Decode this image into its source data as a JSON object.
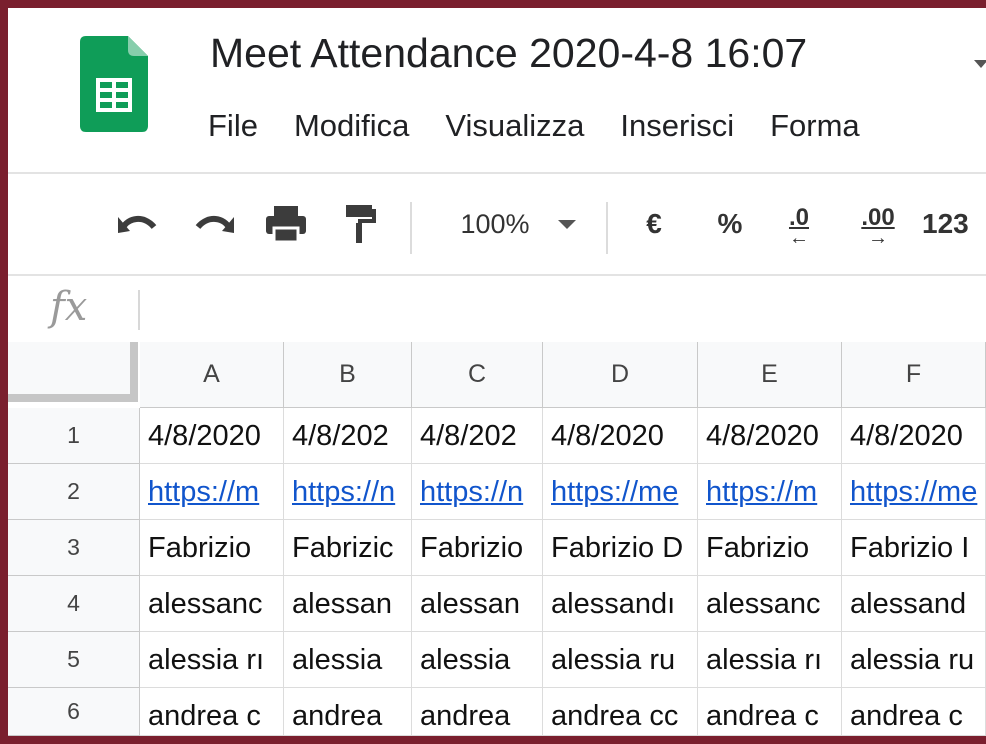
{
  "doc": {
    "title": "Meet Attendance 2020-4-8 16:07"
  },
  "icons": {
    "logo": "google-sheets-logo",
    "brand_color": "#0f9d58"
  },
  "menu": [
    "File",
    "Modifica",
    "Visualizza",
    "Inserisci",
    "Forma"
  ],
  "toolbar": {
    "undo": "undo-icon",
    "redo": "redo-icon",
    "print": "print-icon",
    "paint": "paint-format-icon",
    "zoom": "100%",
    "currency": "€",
    "percent": "%",
    "dec_less": ".0",
    "dec_more": ".00",
    "more_formats": "123"
  },
  "formula_bar": {
    "fx": "fx"
  },
  "sheet": {
    "columns": [
      "A",
      "B",
      "C",
      "D",
      "E",
      "F"
    ],
    "rows": [
      {
        "num": "1",
        "cells": [
          "4/8/2020",
          "4/8/202",
          "4/8/202",
          "4/8/2020",
          "4/8/2020",
          "4/8/2020"
        ]
      },
      {
        "num": "2",
        "cells": [
          "https://m",
          "https://n",
          "https://n",
          "https://me",
          "https://m",
          "https://me"
        ]
      },
      {
        "num": "3",
        "cells": [
          "Fabrizio",
          "Fabrizic",
          "Fabrizio",
          "Fabrizio D",
          "Fabrizio",
          "Fabrizio I"
        ]
      },
      {
        "num": "4",
        "cells": [
          "alessanc",
          "alessan",
          "alessan",
          "alessandı",
          "alessanc",
          "alessand"
        ]
      },
      {
        "num": "5",
        "cells": [
          "alessia rı",
          "alessia",
          "alessia",
          "alessia ru",
          "alessia rı",
          "alessia ru"
        ]
      },
      {
        "num": "6",
        "cells": [
          "andrea c",
          "andrea",
          "andrea",
          "andrea cc",
          "andrea c",
          "andrea c"
        ]
      }
    ]
  }
}
